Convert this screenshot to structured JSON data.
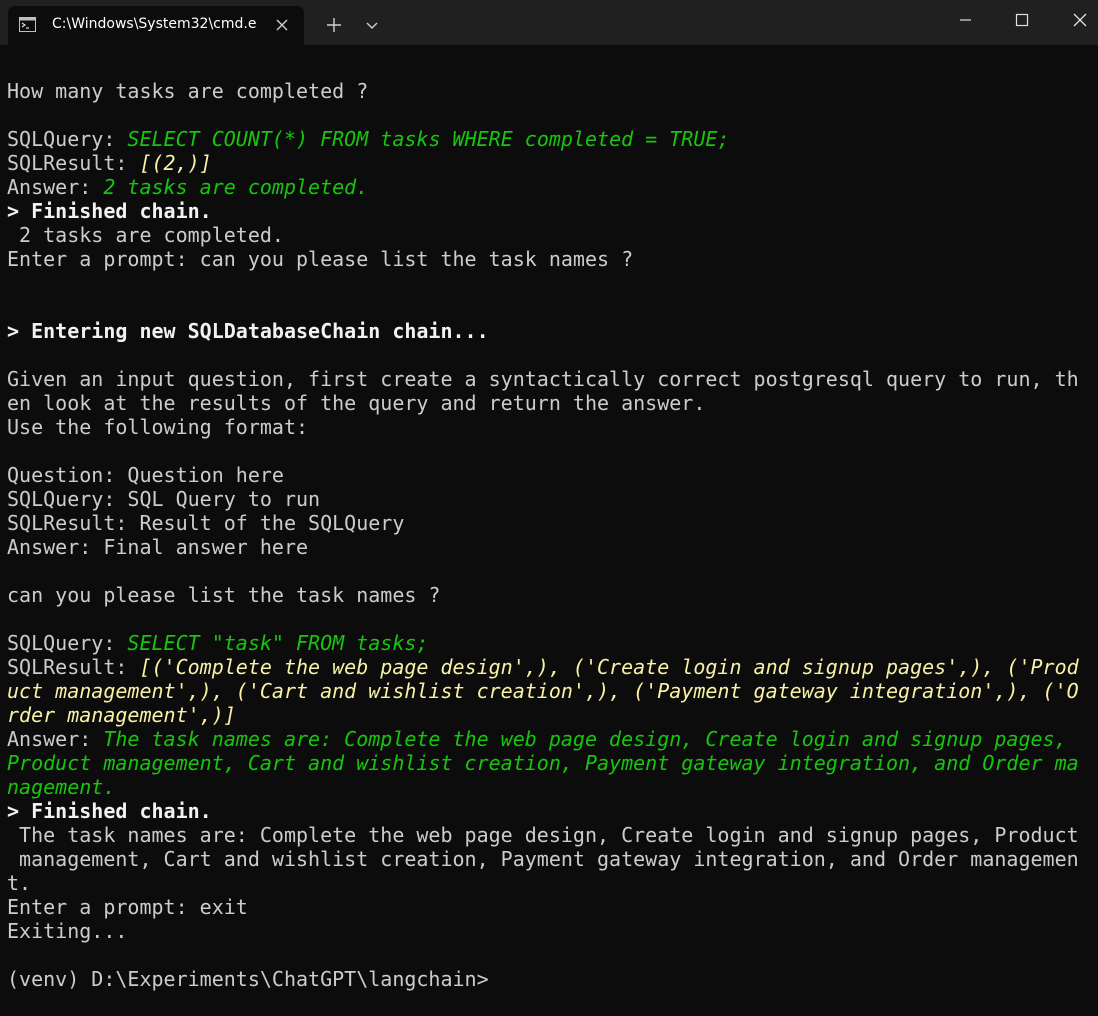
{
  "window": {
    "tab_title": "C:\\Windows\\System32\\cmd.e",
    "icons": {
      "tab": "cmd-terminal-icon",
      "close_tab": "close-icon",
      "new_tab": "plus-icon",
      "dropdown": "chevron-down-icon",
      "minimize": "minimize-icon",
      "maximize": "maximize-icon",
      "close_window": "close-icon"
    }
  },
  "colors": {
    "background": "#0c0c0c",
    "titlebar": "#202020",
    "text": "#cccccc",
    "green": "#16c60c",
    "yellow": "#f9f1a5",
    "bright": "#f2f2f2"
  },
  "terminal": {
    "lines": [
      [
        {
          "t": "How many tasks are completed ?"
        }
      ],
      [],
      [
        {
          "t": "SQLQuery: "
        },
        {
          "t": "SELECT COUNT(*) FROM tasks WHERE completed = TRUE;",
          "c": "g"
        }
      ],
      [
        {
          "t": "SQLResult: "
        },
        {
          "t": "[(2,)]",
          "c": "y"
        }
      ],
      [
        {
          "t": "Answer: "
        },
        {
          "t": "2 tasks are completed.",
          "c": "g"
        }
      ],
      [
        {
          "t": "> Finished chain.",
          "c": "w"
        }
      ],
      [
        {
          "t": " 2 tasks are completed."
        }
      ],
      [
        {
          "t": "Enter a prompt: can you please list the task names ?"
        }
      ],
      [],
      [],
      [
        {
          "t": "> Entering new SQLDatabaseChain chain...",
          "c": "w"
        }
      ],
      [],
      [
        {
          "t": "Given an input question, first create a syntactically correct postgresql query to run, th"
        }
      ],
      [
        {
          "t": "en look at the results of the query and return the answer."
        }
      ],
      [
        {
          "t": "Use the following format:"
        }
      ],
      [],
      [
        {
          "t": "Question: Question here"
        }
      ],
      [
        {
          "t": "SQLQuery: SQL Query to run"
        }
      ],
      [
        {
          "t": "SQLResult: Result of the SQLQuery"
        }
      ],
      [
        {
          "t": "Answer: Final answer here"
        }
      ],
      [],
      [
        {
          "t": "can you please list the task names ?"
        }
      ],
      [],
      [
        {
          "t": "SQLQuery: "
        },
        {
          "t": "SELECT \"task\" FROM tasks;",
          "c": "g"
        }
      ],
      [
        {
          "t": "SQLResult: "
        },
        {
          "t": "[('Complete the web page design',), ('Create login and signup pages',), ('Prod",
          "c": "y"
        }
      ],
      [
        {
          "t": "uct management',), ('Cart and wishlist creation',), ('Payment gateway integration',), ('O",
          "c": "y"
        }
      ],
      [
        {
          "t": "rder management',)]",
          "c": "y"
        }
      ],
      [
        {
          "t": "Answer: "
        },
        {
          "t": "The task names are: Complete the web page design, Create login and signup pages,",
          "c": "g"
        }
      ],
      [
        {
          "t": "Product management, Cart and wishlist creation, Payment gateway integration, and Order ma",
          "c": "g"
        }
      ],
      [
        {
          "t": "nagement.",
          "c": "g"
        }
      ],
      [
        {
          "t": "> Finished chain.",
          "c": "w"
        }
      ],
      [
        {
          "t": " The task names are: Complete the web page design, Create login and signup pages, Product"
        }
      ],
      [
        {
          "t": " management, Cart and wishlist creation, Payment gateway integration, and Order managemen"
        }
      ],
      [
        {
          "t": "t."
        }
      ],
      [
        {
          "t": "Enter a prompt: exit"
        }
      ],
      [
        {
          "t": "Exiting..."
        }
      ],
      [],
      [
        {
          "t": "(venv) D:\\Experiments\\ChatGPT\\langchain>"
        }
      ]
    ]
  }
}
